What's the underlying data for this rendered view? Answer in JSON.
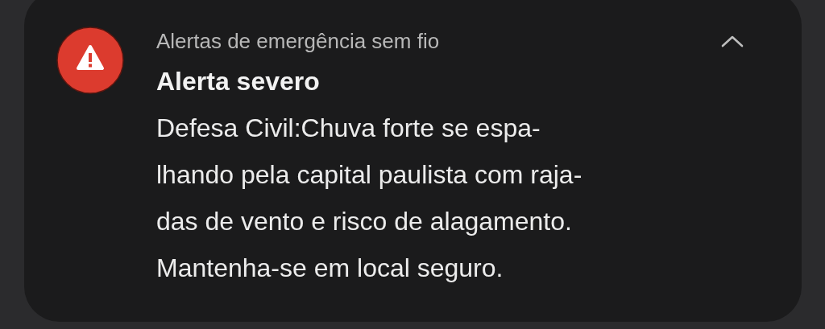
{
  "notification": {
    "app_name": "Alertas de emergência sem fio",
    "expanded": true,
    "title": "Alerta severo",
    "body_lines": [
      "Defesa Civil:Chuva forte se espa-",
      "lhando pela capital paulista com raja-",
      "das de vento e risco de alagamento.",
      "Mantenha-se em local seguro."
    ]
  }
}
